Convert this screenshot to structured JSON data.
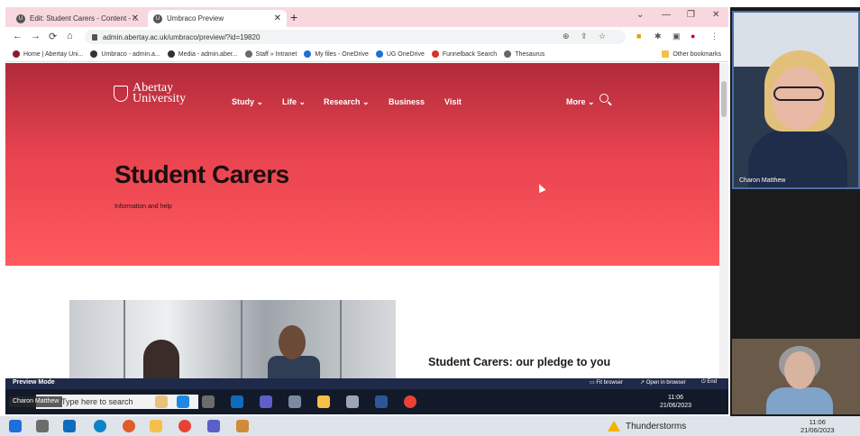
{
  "browser": {
    "tabs": [
      {
        "label": "Edit: Student Carers - Content - ..."
      },
      {
        "label": "Umbraco Preview"
      }
    ],
    "url": "admin.abertay.ac.uk/umbraco/preview/?id=19820",
    "bookmarks": [
      {
        "label": "Home | Abertay Uni...",
        "color": "#8a1a2b"
      },
      {
        "label": "Umbraco - admin.a...",
        "color": "#333333"
      },
      {
        "label": "Media - admin.aber...",
        "color": "#333333"
      },
      {
        "label": "Staff » Intranet",
        "color": "#6a6a6a"
      },
      {
        "label": "My files - OneDrive",
        "color": "#1e6fd9"
      },
      {
        "label": "UG OneDrive",
        "color": "#1e6fd9"
      },
      {
        "label": "Funnelback Search",
        "color": "#d93025"
      },
      {
        "label": "Thesaurus",
        "color": "#666666"
      }
    ],
    "other_bookmarks": "Other bookmarks"
  },
  "site": {
    "logo_line1": "Abertay",
    "logo_line2": "University",
    "nav": [
      "Study ⌄",
      "Life ⌄",
      "Research ⌄",
      "Business",
      "Visit"
    ],
    "more": "More ⌄",
    "hero_title": "Student Carers",
    "hero_subtitle": "Information and help",
    "pledge_heading": "Student Carers: our pledge to you"
  },
  "preview_bar": {
    "label": "Preview Mode",
    "fit_browser": "Fit browser",
    "open_in_browser": "Open in browser",
    "end": "End"
  },
  "inner_taskbar": {
    "search_placeholder": "Type here to search",
    "time": "11:06",
    "date": "21/06/2023"
  },
  "outer_taskbar": {
    "weather": "Thunderstorms",
    "time": "11:06",
    "date": "21/06/2023"
  },
  "participants": [
    {
      "name": "Charon Matthew"
    },
    {
      "name": "Charon Matthew"
    }
  ],
  "colors": {
    "hero_red": "#ff5a5e",
    "preview_navy": "#1f2a4a"
  }
}
